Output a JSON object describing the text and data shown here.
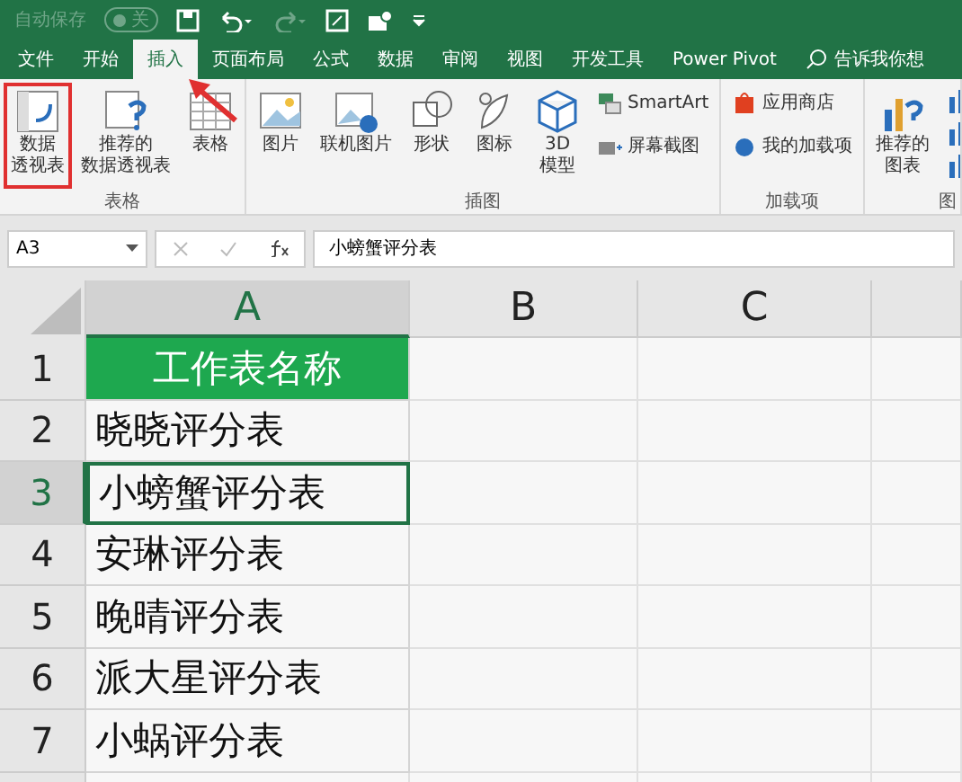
{
  "title_bar": {
    "autosave_label": "自动保存",
    "autosave_state": "关",
    "autosave_on": false
  },
  "tabs": [
    {
      "label": "文件",
      "selected": false
    },
    {
      "label": "开始",
      "selected": false
    },
    {
      "label": "插入",
      "selected": true
    },
    {
      "label": "页面布局",
      "selected": false
    },
    {
      "label": "公式",
      "selected": false
    },
    {
      "label": "数据",
      "selected": false
    },
    {
      "label": "审阅",
      "selected": false
    },
    {
      "label": "视图",
      "selected": false
    },
    {
      "label": "开发工具",
      "selected": false
    },
    {
      "label": "Power Pivot",
      "selected": false
    }
  ],
  "tell_me": "告诉我你想",
  "ribbon_groups": [
    {
      "label": "表格",
      "items": [
        {
          "kind": "large",
          "label_lines": [
            "数据",
            "透视表"
          ],
          "highlighted": true
        },
        {
          "kind": "large",
          "label_lines": [
            "推荐的",
            "数据透视表"
          ],
          "highlighted": false
        },
        {
          "kind": "large",
          "label_lines": [
            "表格"
          ],
          "highlighted": false
        }
      ]
    },
    {
      "label": "插图",
      "items": [
        {
          "kind": "large",
          "label_lines": [
            "图片"
          ],
          "highlighted": false
        },
        {
          "kind": "large",
          "label_lines": [
            "联机图片"
          ],
          "highlighted": false
        },
        {
          "kind": "large",
          "label_lines": [
            "形状"
          ],
          "highlighted": false
        },
        {
          "kind": "large",
          "label_lines": [
            "图标"
          ],
          "highlighted": false
        },
        {
          "kind": "large",
          "label_lines": [
            "3D",
            "模型"
          ],
          "highlighted": false
        },
        {
          "kind": "small",
          "label": "SmartArt",
          "highlighted": false
        },
        {
          "kind": "small",
          "label": "屏幕截图",
          "highlighted": false
        }
      ]
    },
    {
      "label": "加载项",
      "items": [
        {
          "kind": "small",
          "label": "应用商店",
          "highlighted": false
        },
        {
          "kind": "small",
          "label": "我的加载项",
          "highlighted": false
        }
      ]
    },
    {
      "label": "图",
      "items": [
        {
          "kind": "large",
          "label_lines": [
            "推荐的",
            "图表"
          ],
          "highlighted": false
        },
        {
          "kind": "charts"
        }
      ]
    }
  ],
  "name_box": "A3",
  "formula": "小螃蟹评分表",
  "columns": [
    {
      "label": "A",
      "selected": true
    },
    {
      "label": "B",
      "selected": false
    },
    {
      "label": "C",
      "selected": false
    }
  ],
  "rows": [
    {
      "number": "1",
      "value": "工作表名称",
      "kind": "header",
      "selected": false
    },
    {
      "number": "2",
      "value": "晓晓评分表",
      "kind": "data",
      "selected": false
    },
    {
      "number": "3",
      "value": "小螃蟹评分表",
      "kind": "data",
      "selected": true
    },
    {
      "number": "4",
      "value": "安琳评分表",
      "kind": "data",
      "selected": false
    },
    {
      "number": "5",
      "value": "晚晴评分表",
      "kind": "data",
      "selected": false
    },
    {
      "number": "6",
      "value": "派大星评分表",
      "kind": "data",
      "selected": false
    },
    {
      "number": "7",
      "value": "小蜗评分表",
      "kind": "data",
      "selected": false
    }
  ]
}
